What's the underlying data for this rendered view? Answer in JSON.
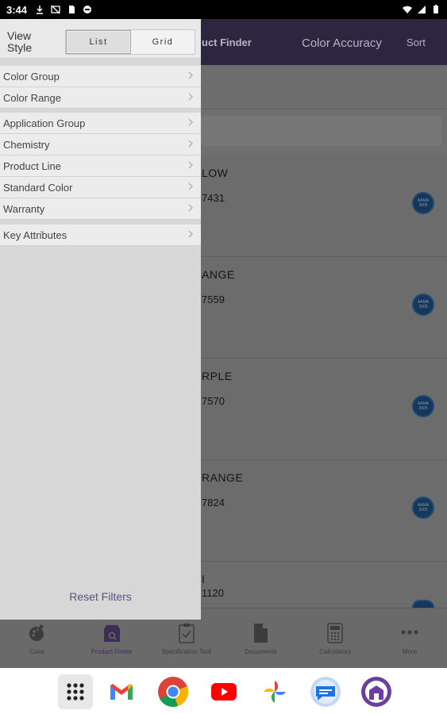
{
  "status_bar": {
    "time": "3:44"
  },
  "app": {
    "header": {
      "title_partial": "uct Finder",
      "color_accuracy": "Color Accuracy",
      "sort": "Sort"
    },
    "results": [
      {
        "name_partial": "LOW",
        "code_partial": "7431"
      },
      {
        "name_partial": "ANGE",
        "code_partial": "7559"
      },
      {
        "name_partial": "RPLE",
        "code_partial": "7570"
      },
      {
        "name_partial": "RANGE",
        "code_partial": "7824"
      },
      {
        "name_partial": "I",
        "code_partial": "1120"
      }
    ],
    "badge_text": [
      "AAMA",
      "2605"
    ],
    "tabs": [
      {
        "label": "Color",
        "icon": "palette-icon"
      },
      {
        "label": "Product Finder",
        "icon": "product-finder-icon"
      },
      {
        "label": "Specification Tool",
        "icon": "clipboard-check-icon"
      },
      {
        "label": "Documents",
        "icon": "document-icon"
      },
      {
        "label": "Calculators",
        "icon": "calculator-icon"
      },
      {
        "label": "More",
        "icon": "more-dots-icon"
      }
    ]
  },
  "drawer": {
    "view_style_label": "View Style",
    "view_options": [
      "List",
      "Grid"
    ],
    "selected_view": "List",
    "groups": [
      [
        "Color Group",
        "Color Range"
      ],
      [
        "Application Group",
        "Chemistry",
        "Product Line",
        "Standard Color",
        "Warranty"
      ],
      [
        "Key Attributes"
      ]
    ],
    "reset_label": "Reset Filters"
  },
  "dock": [
    "app-drawer-icon",
    "gmail-icon",
    "chrome-icon",
    "youtube-icon",
    "photos-icon",
    "messages-icon",
    "app-icon"
  ],
  "colors": {
    "accent": "#2e2540",
    "link": "#5a5185",
    "drawer_bg": "#d7d7d7"
  }
}
